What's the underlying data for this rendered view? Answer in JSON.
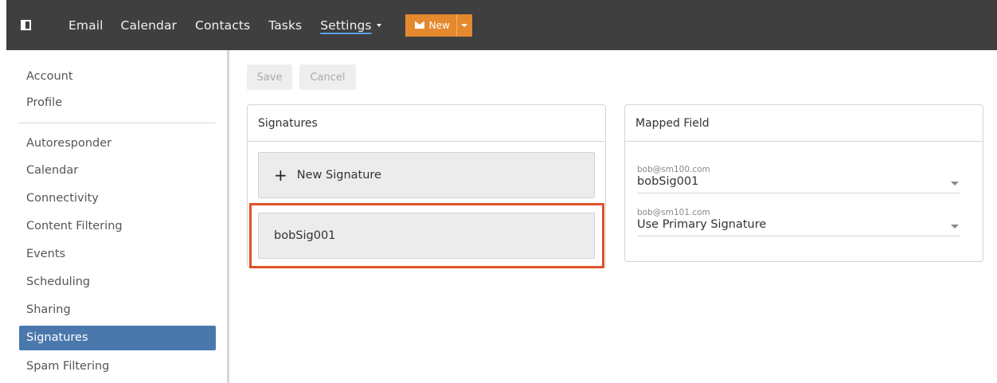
{
  "topbar": {
    "nav": [
      {
        "label": "Email"
      },
      {
        "label": "Calendar"
      },
      {
        "label": "Contacts"
      },
      {
        "label": "Tasks"
      },
      {
        "label": "Settings"
      }
    ],
    "new_label": "New"
  },
  "sidebar": {
    "items": [
      {
        "label": "Account"
      },
      {
        "label": "Profile"
      },
      {
        "label": "Autoresponder"
      },
      {
        "label": "Calendar"
      },
      {
        "label": "Connectivity"
      },
      {
        "label": "Content Filtering"
      },
      {
        "label": "Events"
      },
      {
        "label": "Scheduling"
      },
      {
        "label": "Sharing"
      },
      {
        "label": "Signatures"
      },
      {
        "label": "Spam Filtering"
      }
    ]
  },
  "toolbar": {
    "save_label": "Save",
    "cancel_label": "Cancel"
  },
  "signatures_panel": {
    "title": "Signatures",
    "new_label": "New Signature",
    "items": [
      {
        "name": "bobSig001"
      }
    ]
  },
  "mapped_field_panel": {
    "title": "Mapped Field",
    "rows": [
      {
        "email": "bob@sm100.com",
        "value": "bobSig001"
      },
      {
        "email": "bob@sm101.com",
        "value": "Use Primary Signature"
      }
    ]
  },
  "colors": {
    "topbar_bg": "#3f3f3f",
    "accent_orange": "#e5892e",
    "active_blue": "#4a78ad",
    "highlight_red": "#e0522b"
  }
}
